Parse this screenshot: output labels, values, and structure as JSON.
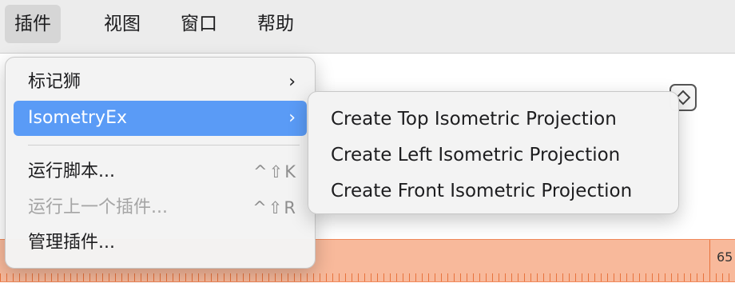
{
  "menubar": {
    "items": [
      {
        "label": "插件",
        "active": true
      },
      {
        "label": "视图",
        "active": false
      },
      {
        "label": "窗口",
        "active": false
      },
      {
        "label": "帮助",
        "active": false
      }
    ]
  },
  "background": {
    "ruler_number": "65"
  },
  "menu": {
    "items": [
      {
        "label": "标记狮",
        "arrow": "›"
      },
      {
        "label": "IsometryEx",
        "arrow": "›"
      },
      {
        "label": "运行脚本...",
        "shortcut": "^⇧K"
      },
      {
        "label": "运行上一个插件...",
        "shortcut": "^⇧R"
      },
      {
        "label": "管理插件..."
      }
    ]
  },
  "submenu": {
    "items": [
      {
        "label": "Create Top Isometric Projection"
      },
      {
        "label": "Create Left Isometric Projection"
      },
      {
        "label": "Create Front Isometric Projection"
      }
    ]
  },
  "colors": {
    "highlight": "#5a9bf6",
    "ruler": "#f8b99b"
  }
}
